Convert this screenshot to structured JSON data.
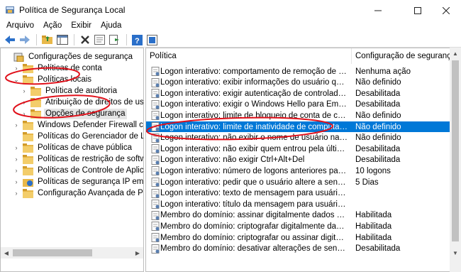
{
  "window": {
    "title": "Política de Segurança Local"
  },
  "menu": [
    "Arquivo",
    "Ação",
    "Exibir",
    "Ajuda"
  ],
  "toolbar": [
    "back-icon",
    "forward-icon",
    "up-folder-icon",
    "console-tree-icon",
    "delete-icon",
    "properties-icon",
    "export-icon",
    "help-icon",
    "help-book-icon"
  ],
  "tree": [
    {
      "label": "Configurações de segurança",
      "expander": "",
      "icon": "security",
      "level": 0
    },
    {
      "label": "Políticas de conta",
      "expander": "›",
      "icon": "folder",
      "level": 1
    },
    {
      "label": "Políticas locais",
      "expander": "⌄",
      "icon": "folder",
      "level": 1
    },
    {
      "label": "Política de auditoria",
      "expander": "›",
      "icon": "folder",
      "level": 2
    },
    {
      "label": "Atribuição de direitos de usuário",
      "expander": "›",
      "icon": "folder",
      "level": 2
    },
    {
      "label": "Opções de segurança",
      "expander": "›",
      "icon": "folder",
      "level": 2,
      "selected": true
    },
    {
      "label": "Windows Defender Firewall com Segur",
      "expander": "›",
      "icon": "folder",
      "level": 1
    },
    {
      "label": "Políticas do Gerenciador de Listas de R",
      "expander": "",
      "icon": "folder",
      "level": 1
    },
    {
      "label": "Políticas de chave pública",
      "expander": "›",
      "icon": "folder",
      "level": 1
    },
    {
      "label": "Políticas de restrição de software",
      "expander": "›",
      "icon": "folder",
      "level": 1
    },
    {
      "label": "Políticas de Controle de Aplicativo",
      "expander": "›",
      "icon": "folder",
      "level": 1
    },
    {
      "label": "Políticas de segurança IP em Computa",
      "expander": "›",
      "icon": "shield",
      "level": 1
    },
    {
      "label": "Configuração Avançada de Política de",
      "expander": "›",
      "icon": "folder",
      "level": 1
    }
  ],
  "columns": {
    "policy": "Política",
    "setting": "Configuração de seguranç"
  },
  "rows": [
    {
      "policy": "Logon interativo: comportamento de remoção de cartão intel...",
      "setting": "Nenhuma ação"
    },
    {
      "policy": "Logon interativo: exibir informações do usuário quando a ses...",
      "setting": "Não definido"
    },
    {
      "policy": "Logon interativo: exigir autenticação de controlador de domin...",
      "setting": "Desabilitada"
    },
    {
      "policy": "Logon interativo: exigir o Windows Hello para Empresas ou c...",
      "setting": "Desabilitada"
    },
    {
      "policy": "Logon interativo: limite de bloqueio de conta de computador",
      "setting": "Não definido"
    },
    {
      "policy": "Logon interativo: limite de inatividade de computador",
      "setting": "Não definido",
      "selected": true
    },
    {
      "policy": "Logon interativo: não exibir o nome de usuário na entrada",
      "setting": "Não definido"
    },
    {
      "policy": "Logon interativo: não exibir quem entrou pela última vez",
      "setting": "Desabilitada"
    },
    {
      "policy": "Logon interativo: não exigir Ctrl+Alt+Del",
      "setting": "Desabilitada"
    },
    {
      "policy": "Logon interativo: número de logons anteriores para armazen...",
      "setting": "10 logons"
    },
    {
      "policy": "Logon interativo: pedir que o usuário altere a senha antes qu...",
      "setting": "5 Dias"
    },
    {
      "policy": "Logon interativo: texto de mensagem para usuários tentando...",
      "setting": ""
    },
    {
      "policy": "Logon interativo: título da mensagem para usuários tentando...",
      "setting": ""
    },
    {
      "policy": "Membro do domínio: assinar digitalmente dados do canal se...",
      "setting": "Habilitada"
    },
    {
      "policy": "Membro do domínio: criptografar digitalmente dados do cana...",
      "setting": "Habilitada"
    },
    {
      "policy": "Membro do domínio: criptografar ou assinar digitalmente da...",
      "setting": "Habilitada"
    },
    {
      "policy": "Membro do domínio: desativar alterações de senha de conta ...",
      "setting": "Desabilitada"
    }
  ],
  "colors": {
    "selection": "#0078d7",
    "annotation": "#e0101a",
    "folder": "#e8b84a"
  }
}
